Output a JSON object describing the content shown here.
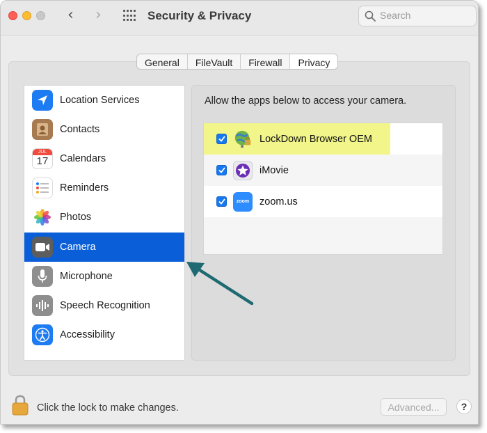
{
  "window": {
    "title": "Security & Privacy",
    "search_placeholder": "Search"
  },
  "tabs": [
    {
      "label": "General",
      "active": false
    },
    {
      "label": "FileVault",
      "active": false
    },
    {
      "label": "Firewall",
      "active": false
    },
    {
      "label": "Privacy",
      "active": true
    }
  ],
  "sidebar": {
    "items": [
      {
        "label": "Location Services",
        "icon": "location-arrow-icon"
      },
      {
        "label": "Contacts",
        "icon": "contacts-icon"
      },
      {
        "label": "Calendars",
        "icon": "calendar-icon",
        "icon_month": "JUL",
        "icon_day": "17"
      },
      {
        "label": "Reminders",
        "icon": "reminders-icon"
      },
      {
        "label": "Photos",
        "icon": "photos-icon"
      },
      {
        "label": "Camera",
        "icon": "camera-icon",
        "selected": true
      },
      {
        "label": "Microphone",
        "icon": "microphone-icon"
      },
      {
        "label": "Speech Recognition",
        "icon": "speech-waveform-icon"
      },
      {
        "label": "Accessibility",
        "icon": "accessibility-icon"
      }
    ]
  },
  "camera_pane": {
    "header": "Allow the apps below to access your camera.",
    "apps": [
      {
        "name": "LockDown Browser OEM",
        "checked": true,
        "highlighted": true,
        "icon": "lockdown-globe-icon"
      },
      {
        "name": "iMovie",
        "checked": true,
        "highlighted": false,
        "icon": "imovie-star-icon"
      },
      {
        "name": "zoom.us",
        "checked": true,
        "highlighted": false,
        "icon": "zoom-icon",
        "icon_text": "zoom"
      }
    ]
  },
  "footer": {
    "lock_text": "Click the lock to make changes.",
    "advanced_label": "Advanced...",
    "help_label": "?"
  },
  "colors": {
    "selection": "#0a5fd8",
    "checkbox": "#1779f0",
    "highlight": "#f1f58a",
    "arrow": "#1f6a72"
  }
}
